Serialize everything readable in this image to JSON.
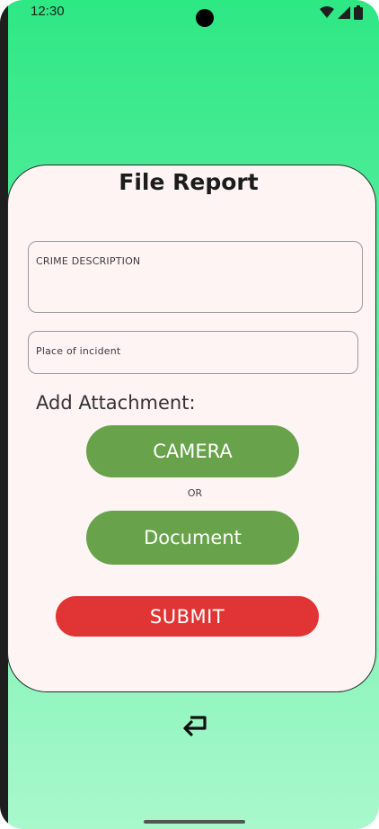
{
  "status_bar": {
    "time": "12:30",
    "icons": [
      "wifi-icon",
      "cellular-signal-icon",
      "battery-icon"
    ]
  },
  "form": {
    "title": "File Report",
    "crime_description_placeholder": "CRIME DESCRIPTION",
    "place_placeholder": "Place of incident",
    "attachment_label": "Add Attachment:",
    "camera_label": "CAMERA",
    "or_label": "OR",
    "document_label": "Document",
    "submit_label": "SUBMIT"
  },
  "navigation": {
    "back_icon": "return-arrow-icon"
  },
  "colors": {
    "background_top": "#2ee884",
    "background_bottom": "#a8f8cc",
    "card": "#fdf4f3",
    "green_button": "#68a24a",
    "submit_button": "#e03534"
  }
}
